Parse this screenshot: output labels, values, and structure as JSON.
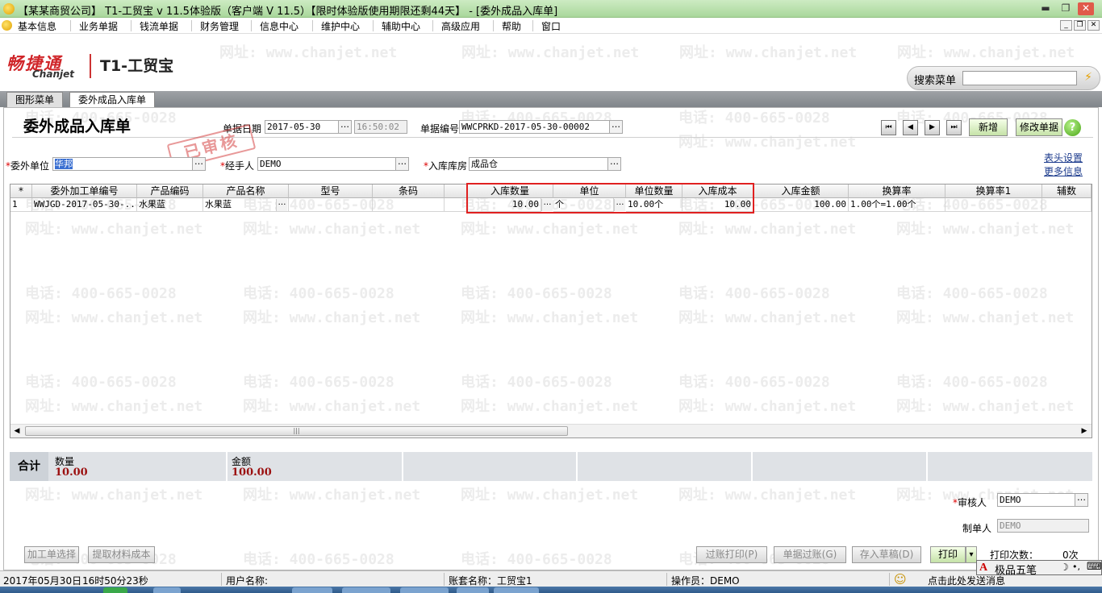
{
  "window": {
    "title": "【某某商贸公司】 T1-工贸宝 v 11.5体验版（客户端 V 11.5）【限时体验版使用期限还剩44天】 - [委外成品入库单]",
    "controls": {
      "minimize": "▬",
      "restore": "❐",
      "close": "✕"
    }
  },
  "menu": [
    "基本信息",
    "业务单据",
    "钱流单据",
    "财务管理",
    "信息中心",
    "维护中心",
    "辅助中心",
    "高级应用",
    "帮助",
    "窗口"
  ],
  "mdi_controls": {
    "minimize": "_",
    "restore": "❐",
    "close": "✕"
  },
  "brand": {
    "logo_cn": "畅捷通",
    "logo_en": "Chanjet",
    "product": "T1-工贸宝"
  },
  "search": {
    "label": "搜索菜单",
    "value": "",
    "go_icon": "lightning-icon"
  },
  "tabs": [
    {
      "label": "图形菜单",
      "active": false
    },
    {
      "label": "委外成品入库单",
      "active": true
    }
  ],
  "watermark": {
    "phone": "电话: 400-665-0028",
    "site": "网址: www.chanjet.net"
  },
  "form": {
    "title": "委外成品入库单",
    "date_label": "单据日期",
    "date": "2017-05-30",
    "time": "16:50:02",
    "number_label": "单据编号",
    "number": "WWCPRKD-2017-05-30-00002",
    "stamp": "已审核",
    "nav": {
      "first": "⏮",
      "prev": "◀",
      "next": "▶",
      "last": "⏭"
    },
    "new_button": "新增",
    "edit_button": "修改单据",
    "help_icon": "?",
    "outsource_unit_label": "委外单位",
    "outsource_unit": "华邦",
    "handler_label": "经手人",
    "handler": "DEMO",
    "warehouse_label": "入库库房",
    "warehouse": "成品仓",
    "header_settings_link": "表头设置",
    "more_info_link": "更多信息",
    "ellipsis": "…",
    "required_mark": "*"
  },
  "grid": {
    "columns": [
      "*",
      "委外加工单编号",
      "产品编码",
      "产品名称",
      "型号",
      "条码",
      "",
      "入库数量",
      "单位",
      "单位数量",
      "入库成本",
      "入库金额",
      "换算率",
      "换算率1",
      "辅数"
    ],
    "rows": [
      {
        "idx": "1",
        "order_no": "WWJGD-2017-05-30-...",
        "product_code": "水果蓝",
        "product_name": "水果蓝",
        "model": "",
        "barcode": "",
        "blank": "",
        "qty": "10.00",
        "unit": "个",
        "unit_qty": "10.00个",
        "cost": "10.00",
        "amount": "100.00",
        "rate": "1.00个=1.00个",
        "rate1": "",
        "aux": ""
      }
    ],
    "scroll_left": "◀",
    "scroll_right": "▶",
    "scroll_thumb": "|||"
  },
  "totals": {
    "label": "合计",
    "qty_label": "数量",
    "qty": "10.00",
    "amount_label": "金额",
    "amount": "100.00"
  },
  "footer": {
    "reviewer_label": "审核人",
    "reviewer": "DEMO",
    "maker_label": "制单人",
    "maker": "DEMO",
    "btn_processing_select": "加工单选择",
    "btn_material_cost": "提取材料成本",
    "btn_post_print": "过账打印(P)",
    "btn_post": "单据过账(G)",
    "btn_save_draft": "存入草稿(D)",
    "btn_print": "打印",
    "btn_print_dropdown": "▾",
    "print_count_label": "打印次数：",
    "print_count": "0次"
  },
  "status": {
    "date": "2017年05月30日",
    "time": "16时50分23秒",
    "user_label": "用户名称:",
    "account_set": "账套名称：工贸宝1",
    "operator": "操作员：DEMO",
    "smiley_icon": "☺",
    "message": "点击此处发送消息"
  },
  "ime": {
    "a": "A",
    "name": "极品五笔",
    "moon": "☽",
    "dots": "•,",
    "kbd": "⌨"
  }
}
